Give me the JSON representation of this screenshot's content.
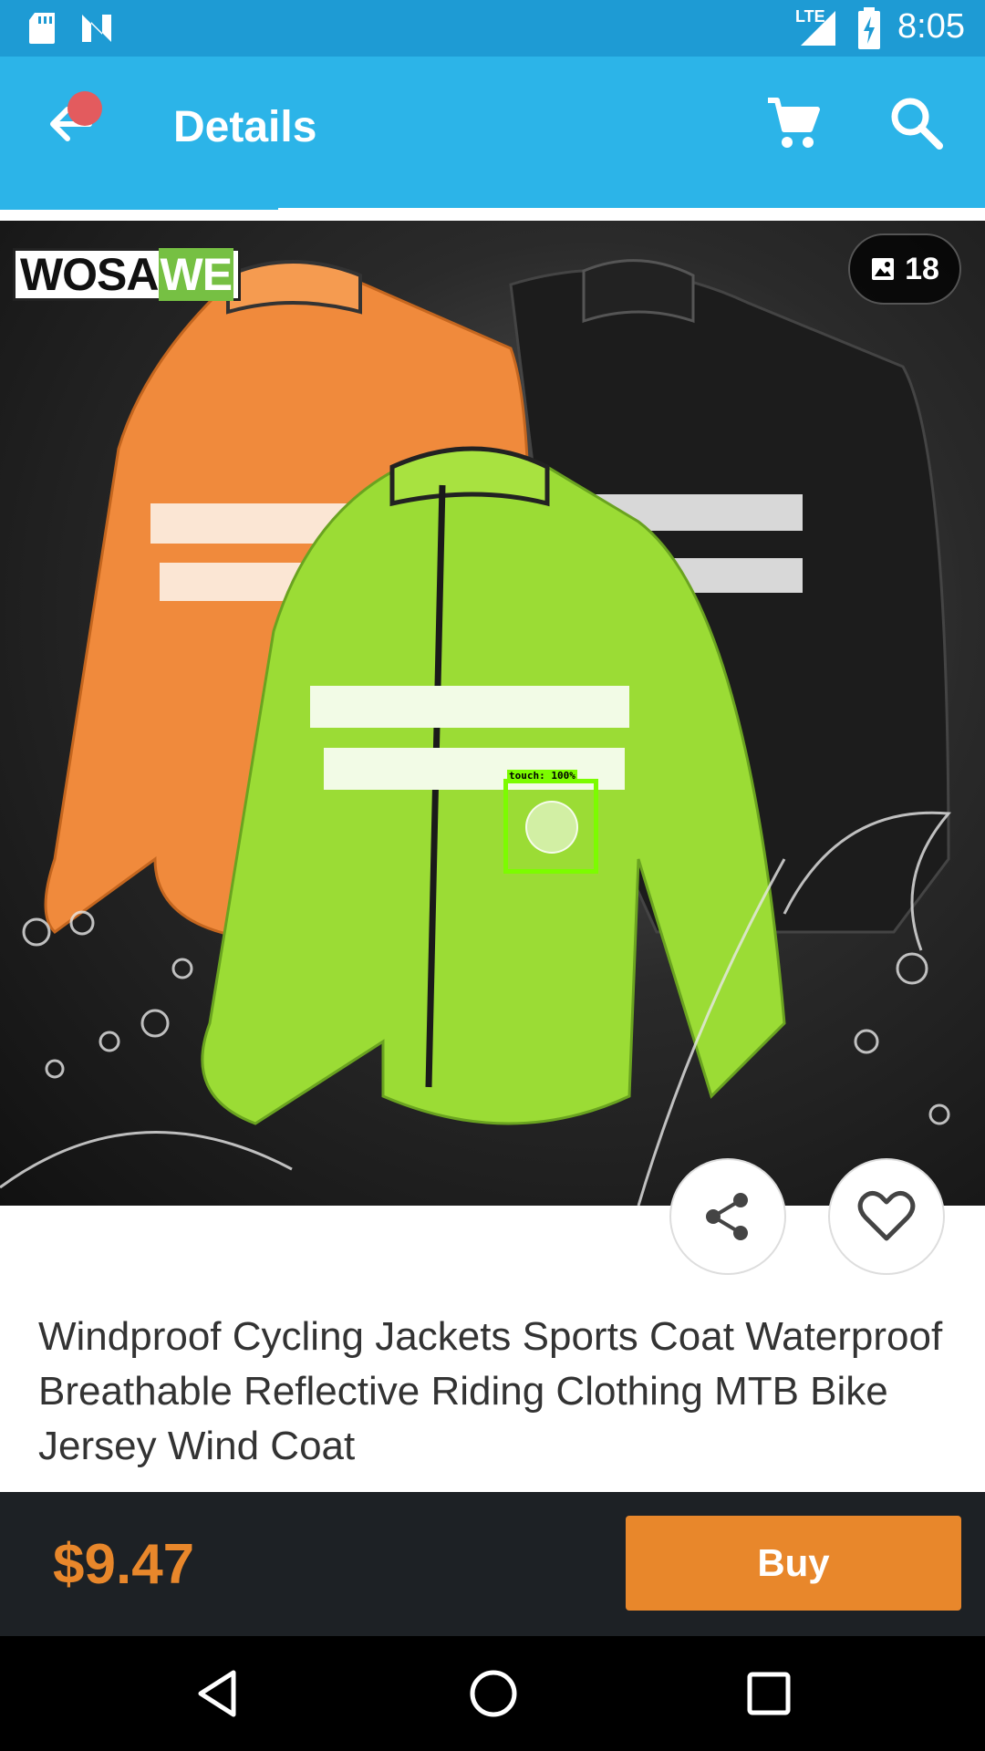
{
  "status_bar": {
    "time": "8:05",
    "network": "LTE",
    "icons": [
      "sd-card-icon",
      "n-notification-icon",
      "signal-icon",
      "battery-charging-icon"
    ]
  },
  "app_bar": {
    "title": "Details",
    "icons": [
      "back-arrow-icon",
      "cart-icon",
      "search-icon"
    ],
    "accent_color": "#2cb4e8"
  },
  "product": {
    "brand": {
      "part1": "WOSA",
      "part2": "WE"
    },
    "image_count": "18",
    "title": "Windproof Cycling Jackets Sports Coat Waterproof Breathable Reflective Riding Clothing MTB Bike Jersey Wind Coat",
    "price": "$9.47",
    "price_color": "#e8872b"
  },
  "overlay": {
    "touch_label": "touch: 100%"
  },
  "actions": {
    "buy_label": "Buy",
    "icons": [
      "share-icon",
      "heart-icon"
    ]
  },
  "nav_bar": {
    "icons": [
      "back-triangle-icon",
      "home-circle-icon",
      "recents-square-icon"
    ]
  }
}
